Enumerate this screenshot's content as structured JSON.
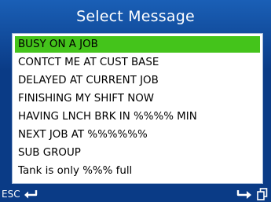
{
  "title": "Select Message",
  "messages": [
    {
      "text": "BUSY ON A JOB",
      "selected": true
    },
    {
      "text": "CONTCT ME  AT CUST BASE",
      "selected": false
    },
    {
      "text": "DELAYED AT CURRENT JOB",
      "selected": false
    },
    {
      "text": "FINISHING MY SHIFT NOW",
      "selected": false
    },
    {
      "text": "HAVING LNCH BRK IN %%%% MIN",
      "selected": false
    },
    {
      "text": "NEXT JOB AT %%%%%%",
      "selected": false
    },
    {
      "text": "SUB GROUP",
      "selected": false
    },
    {
      "text": "Tank is only %%% full",
      "selected": false
    }
  ],
  "bottom_bar": {
    "esc_label": "ESC",
    "back_icon": "back-arrow-icon",
    "enter_icon": "enter-arrow-icon",
    "copy_icon": "copy-icon"
  },
  "colors": {
    "background": "#0a3b86",
    "selection": "#44c41b",
    "list_bg": "#ffffff"
  }
}
